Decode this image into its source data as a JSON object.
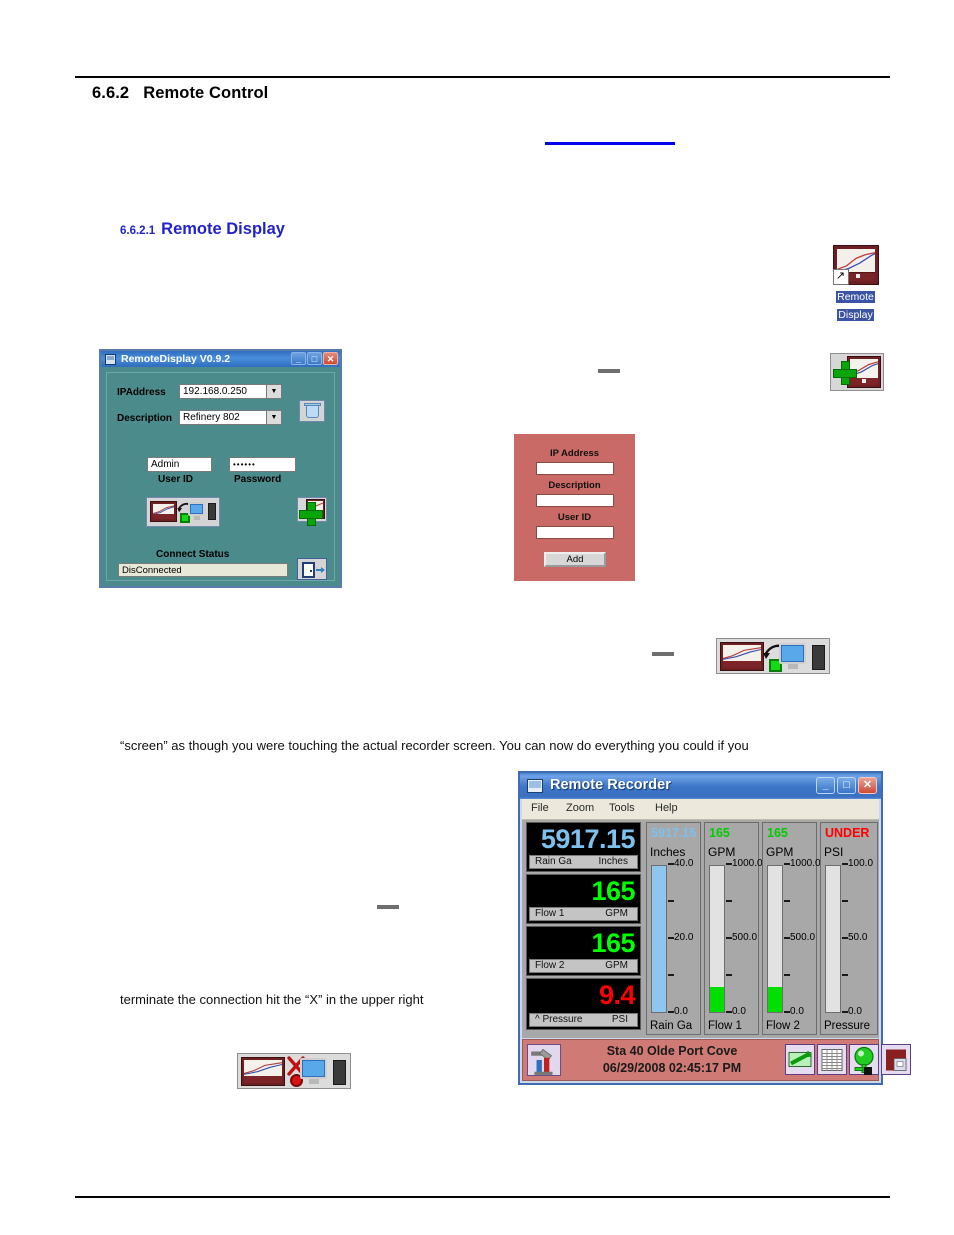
{
  "document": {
    "section_number": "6.6.2",
    "section_title": "Remote Control",
    "subsection_number": "6.6.2.1",
    "subsection_title": "Remote Display",
    "paragraph_1": "“screen” as though you were touching the actual recorder screen. You can now do everything you could if you",
    "paragraph_2": "terminate the connection hit the “X” in the upper right"
  },
  "desktop_icon": {
    "label_line1": "Remote",
    "label_line2": "Display"
  },
  "remote_display_window": {
    "title": "RemoteDisplay V0.9.2",
    "minimize": "_",
    "maximize": "□",
    "close": "✕",
    "ip_label": "IPAddress",
    "ip_value": "192.168.0.250",
    "description_label": "Description",
    "description_value": "Refinery 802",
    "user_id_value": "Admin",
    "user_id_label": "User ID",
    "password_value": "••••••",
    "password_label": "Password",
    "connect_status_label": "Connect Status",
    "connect_status_value": "DisConnected",
    "dropdown_arrow": "▼"
  },
  "add_dialog": {
    "ip_label": "IP Address",
    "description_label": "Description",
    "user_id_label": "User ID",
    "add_button": "Add",
    "ip_value": "",
    "description_value": "",
    "user_id_value": ""
  },
  "remote_recorder": {
    "title": "Remote Recorder",
    "minimize": "_",
    "maximize": "□",
    "close": "✕",
    "menu": [
      "File",
      "Zoom",
      "Tools",
      "Help"
    ],
    "readouts": [
      {
        "value": "5917.15",
        "color": "#7ec0ee",
        "name": "Rain Ga",
        "unit": "Inches"
      },
      {
        "value": "165",
        "color": "#00ff00",
        "name": "Flow 1",
        "unit": "GPM"
      },
      {
        "value": "165",
        "color": "#00ff00",
        "name": "Flow 2",
        "unit": "GPM"
      },
      {
        "value": "9.4",
        "color": "#ff0000",
        "name": "^ Pressure",
        "unit": "PSI"
      }
    ],
    "gauges": [
      {
        "value": "5917.15",
        "value_color": "#7ec0ee",
        "unit": "Inches",
        "name": "Rain Ga",
        "max_label": "40.0",
        "mid_label": "20.0",
        "min_label": "0.0",
        "fill_color": "#8ec6f0",
        "fill_percent": 100
      },
      {
        "value": "165",
        "value_color": "#00cc00",
        "unit": "GPM",
        "name": "Flow 1",
        "max_label": "1000.0",
        "mid_label": "500.0",
        "min_label": "0.0",
        "fill_color": "#00e000",
        "fill_percent": 17
      },
      {
        "value": "165",
        "value_color": "#00cc00",
        "unit": "GPM",
        "name": "Flow 2",
        "max_label": "1000.0",
        "mid_label": "500.0",
        "min_label": "0.0",
        "fill_color": "#00e000",
        "fill_percent": 17
      },
      {
        "value": "UNDER",
        "value_color": "#ff0000",
        "unit": "PSI",
        "name": "Pressure",
        "max_label": "100.0",
        "mid_label": "50.0",
        "min_label": "0.0",
        "fill_color": "#00e000",
        "fill_percent": 0
      }
    ],
    "status_station": "Sta 40 Olde Port Cove",
    "status_datetime": "06/29/2008 02:45:17 PM"
  }
}
